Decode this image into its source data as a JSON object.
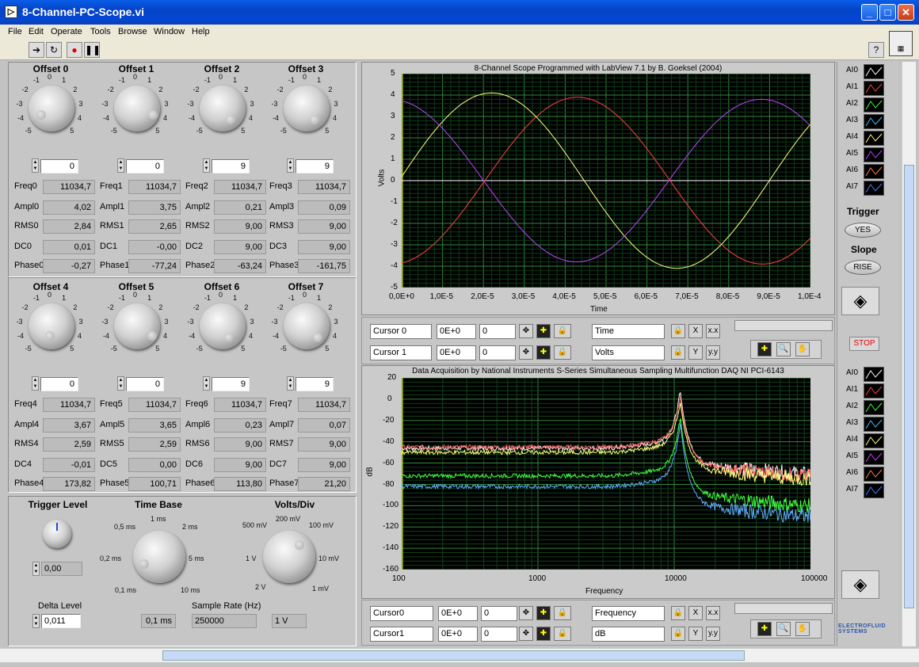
{
  "window": {
    "title": "8-Channel-PC-Scope.vi"
  },
  "menu": [
    "File",
    "Edit",
    "Operate",
    "Tools",
    "Browse",
    "Window",
    "Help"
  ],
  "colors": {
    "ch0": "#ffffff",
    "ch1": "#ff4040",
    "ch2": "#40ff40",
    "ch3": "#40c0ff",
    "ch4": "#ffff80",
    "ch5": "#c040ff",
    "ch6": "#ff8040",
    "ch7": "#4080ff"
  },
  "knob_scale": [
    "-5",
    "-4",
    "-3",
    "-2",
    "-1",
    "0",
    "1",
    "2",
    "3",
    "4",
    "5"
  ],
  "channels": [
    {
      "title": "Offset 0",
      "offset": "0",
      "freq_label": "Freq0",
      "freq": "11034,7",
      "ampl_label": "Ampl0",
      "ampl": "4,02",
      "rms_label": "RMS0",
      "rms": "2,84",
      "dc_label": "DC0",
      "dc": "0,01",
      "phase_label": "Phase0",
      "phase": "-0,27"
    },
    {
      "title": "Offset 1",
      "offset": "0",
      "freq_label": "Freq1",
      "freq": "11034,7",
      "ampl_label": "Ampl1",
      "ampl": "3,75",
      "rms_label": "RMS1",
      "rms": "2,65",
      "dc_label": "DC1",
      "dc": "-0,00",
      "phase_label": "Phase1",
      "phase": "-77,24"
    },
    {
      "title": "Offset 2",
      "offset": "9",
      "freq_label": "Freq2",
      "freq": "11034,7",
      "ampl_label": "Ampl2",
      "ampl": "0,21",
      "rms_label": "RMS2",
      "rms": "9,00",
      "dc_label": "DC2",
      "dc": "9,00",
      "phase_label": "Phase2",
      "phase": "-63,24"
    },
    {
      "title": "Offset 3",
      "offset": "9",
      "freq_label": "Freq3",
      "freq": "11034,7",
      "ampl_label": "Ampl3",
      "ampl": "0,09",
      "rms_label": "RMS3",
      "rms": "9,00",
      "dc_label": "DC3",
      "dc": "9,00",
      "phase_label": "Phase3",
      "phase": "-161,75"
    },
    {
      "title": "Offset 4",
      "offset": "0",
      "freq_label": "Freq4",
      "freq": "11034,7",
      "ampl_label": "Ampl4",
      "ampl": "3,67",
      "rms_label": "RMS4",
      "rms": "2,59",
      "dc_label": "DC4",
      "dc": "-0,01",
      "phase_label": "Phase4",
      "phase": "173,82"
    },
    {
      "title": "Offset 5",
      "offset": "0",
      "freq_label": "Freq5",
      "freq": "11034,7",
      "ampl_label": "Ampl5",
      "ampl": "3,65",
      "rms_label": "RMS5",
      "rms": "2,59",
      "dc_label": "DC5",
      "dc": "0,00",
      "phase_label": "Phase5",
      "phase": "100,71"
    },
    {
      "title": "Offset 6",
      "offset": "9",
      "freq_label": "Freq6",
      "freq": "11034,7",
      "ampl_label": "Ampl6",
      "ampl": "0,23",
      "rms_label": "RMS6",
      "rms": "9,00",
      "dc_label": "DC6",
      "dc": "9,00",
      "phase_label": "Phase6",
      "phase": "113,80"
    },
    {
      "title": "Offset 7",
      "offset": "9",
      "freq_label": "Freq7",
      "freq": "11034,7",
      "ampl_label": "Ampl7",
      "ampl": "0,07",
      "rms_label": "RMS7",
      "rms": "9,00",
      "dc_label": "DC7",
      "dc": "9,00",
      "phase_label": "Phase7",
      "phase": "21,20"
    }
  ],
  "controls": {
    "trigger_level_label": "Trigger Level",
    "trigger_level": "0,00",
    "delta_level_label": "Delta Level",
    "delta_level": "0,011",
    "time_base_label": "Time Base",
    "time_base": "0,1 ms",
    "time_base_scale": [
      "0,1 ms",
      "0,2 ms",
      "0,5 ms",
      "1 ms",
      "2 ms",
      "5 ms",
      "10 ms"
    ],
    "volts_div_label": "Volts/Div",
    "volts_div": "1 V",
    "volts_div_scale": [
      "2 V",
      "1 V",
      "500 mV",
      "200 mV",
      "100 mV",
      "10 mV",
      "1 mV"
    ],
    "sample_rate_label": "Sample Rate (Hz)",
    "sample_rate": "250000"
  },
  "scope": {
    "title": "8-Channel Scope Programmed with LabView 7.1 by B. Goeksel (2004)",
    "xlabel": "Time",
    "ylabel": "Volts",
    "xticks": [
      "0,0E+0",
      "1,0E-5",
      "2,0E-5",
      "3,0E-5",
      "4,0E-5",
      "5,0E-5",
      "6,0E-5",
      "7,0E-5",
      "8,0E-5",
      "9,0E-5",
      "1,0E-4"
    ],
    "yticks": [
      "5",
      "4",
      "3",
      "2",
      "1",
      "0",
      "-1",
      "-2",
      "-3",
      "-4",
      "-5"
    ],
    "cursor0": {
      "name": "Cursor 0",
      "x": "0E+0",
      "y": "0"
    },
    "cursor1": {
      "name": "Cursor 1",
      "x": "0E+0",
      "y": "0"
    },
    "xname": "Time",
    "yname": "Volts"
  },
  "spectrum": {
    "title": "Data Acquisition by National Instruments S-Series Simultaneous Sampling Multifunction DAQ  NI PCI-6143",
    "xlabel": "Frequency",
    "ylabel": "dB",
    "xticks": [
      "100",
      "1000",
      "10000",
      "100000"
    ],
    "yticks": [
      "20",
      "0",
      "-20",
      "-40",
      "-60",
      "-80",
      "-100",
      "-120",
      "-140",
      "-160"
    ],
    "cursor0": {
      "name": "Cursor0",
      "x": "0E+0",
      "y": "0"
    },
    "cursor1": {
      "name": "Cursor1",
      "x": "0E+0",
      "y": "0"
    },
    "xname": "Frequency",
    "yname": "dB"
  },
  "legend": [
    "AI0",
    "AI1",
    "AI2",
    "AI3",
    "AI4",
    "AI5",
    "AI6",
    "AI7"
  ],
  "right": {
    "trigger_label": "Trigger",
    "trigger_btn": "YES",
    "slope_label": "Slope",
    "slope_btn": "RISE",
    "stop": "STOP",
    "brand": "ELECTROFLUID SYSTEMS"
  },
  "chart_data": [
    {
      "type": "line",
      "title": "8-Channel Scope Programmed with LabView 7.1 by B. Goeksel (2004)",
      "xlabel": "Time",
      "ylabel": "Volts",
      "xlim": [
        0,
        0.0001
      ],
      "ylim": [
        -5,
        5
      ],
      "grid": true,
      "series": [
        {
          "name": "AI0",
          "color": "#ffffff",
          "kind": "flat",
          "value": 0
        },
        {
          "name": "AI1",
          "color": "#ff4040",
          "kind": "sine",
          "amp": 3.9,
          "period": 9.06e-05,
          "peak_x": 4.3e-05
        },
        {
          "name": "AI4",
          "color": "#ffff80",
          "kind": "sine",
          "amp": 4.1,
          "period": 9.06e-05,
          "peak_x": 2.2e-05
        },
        {
          "name": "AI5",
          "color": "#c040ff",
          "kind": "sine",
          "amp": 3.8,
          "period": 9.06e-05,
          "peak_x": 8.8e-05
        }
      ]
    },
    {
      "type": "line",
      "title": "Data Acquisition by National Instruments S-Series Simultaneous Sampling Multifunction DAQ  NI PCI-6143",
      "xlabel": "Frequency",
      "ylabel": "dB",
      "xscale": "log",
      "xlim": [
        100,
        100000
      ],
      "ylim": [
        -160,
        20
      ],
      "grid": true,
      "series": [
        {
          "name": "AI0",
          "color": "#ffffff",
          "floor": -46,
          "peak": 0,
          "tail": -70
        },
        {
          "name": "AI1",
          "color": "#ff6060",
          "floor": -45,
          "peak": -5,
          "tail": -72
        },
        {
          "name": "AI2",
          "color": "#40ff40",
          "floor": -72,
          "peak": -25,
          "tail": -100
        },
        {
          "name": "AI3",
          "color": "#60b0ff",
          "floor": -82,
          "peak": -30,
          "tail": -110
        },
        {
          "name": "AI4",
          "color": "#ffff80",
          "floor": -50,
          "peak": -10,
          "tail": -75
        }
      ]
    }
  ]
}
